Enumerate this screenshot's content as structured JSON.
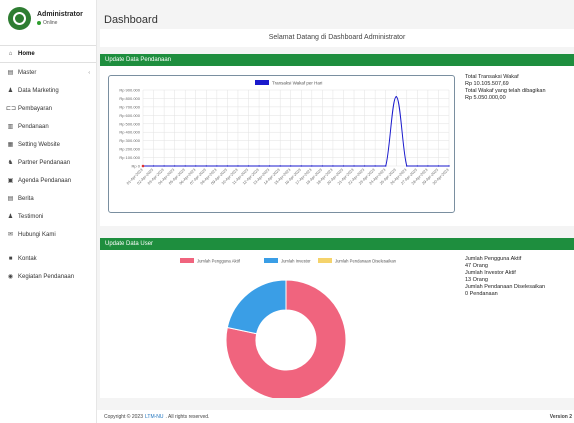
{
  "user": {
    "name": "Administrator",
    "status": "Online"
  },
  "sidebar": {
    "items": [
      {
        "label": "Home",
        "icon": "home-icon",
        "glyph": "⌂"
      },
      {
        "label": "Master",
        "icon": "database-icon",
        "glyph": "▤",
        "caret": "‹"
      },
      {
        "label": "Data Marketing",
        "icon": "user-icon",
        "glyph": "♟"
      },
      {
        "label": "Pembayaran",
        "icon": "payment-icon",
        "glyph": "⊏⊐"
      },
      {
        "label": "Pendanaan",
        "icon": "bank-icon",
        "glyph": "▥"
      },
      {
        "label": "Setting Website",
        "icon": "settings-icon",
        "glyph": "▦"
      },
      {
        "label": "Partner Pendanaan",
        "icon": "users-icon",
        "glyph": "♞"
      },
      {
        "label": "Agenda Pendanaan",
        "icon": "calendar-icon",
        "glyph": "▣"
      },
      {
        "label": "Berita",
        "icon": "newspaper-icon",
        "glyph": "▤"
      },
      {
        "label": "Testimoni",
        "icon": "testimonial-icon",
        "glyph": "♟"
      },
      {
        "label": "Hubungi Kami",
        "icon": "mail-icon",
        "glyph": "✉"
      },
      {
        "label": "Kontak",
        "icon": "address-book-icon",
        "glyph": "■"
      },
      {
        "label": "Kegiatan Pendanaan",
        "icon": "activity-icon",
        "glyph": "◉"
      }
    ]
  },
  "page": {
    "title": "Dashboard",
    "welcome": "Selamat Datang di Dashboard Administrator"
  },
  "funding_card": {
    "header": "Update Data Pendanaan",
    "summary": {
      "total_label": "Total Transaksi Wakaf",
      "total_value": "Rp 10.105.507,69",
      "shared_label": "Total Wakaf yang telah dibagikan",
      "shared_value": "Rp 5.050.000,00"
    }
  },
  "user_card": {
    "header": "Update Data User",
    "summary": {
      "active_label": "Jumlah Pengguna Aktif",
      "active_value": "47 Orang",
      "investor_label": "Jumlah Investor Aktif",
      "investor_value": "13 Orang",
      "funding_label": "Jumlah Pendanaan Diselesaikan",
      "funding_value": "0 Pendanaan"
    }
  },
  "footer": {
    "copyright_prefix": "Copyright © 2023",
    "link": "LTM-NU",
    "copyright_suffix": ". All rights reserved.",
    "version": "Version 2"
  },
  "chart_data": [
    {
      "type": "line",
      "legend": [
        "Transaksi Wakaf per Hari"
      ],
      "colors": [
        "#1a1acc"
      ],
      "yticks": [
        "Rp 900.000",
        "Rp 800.000",
        "Rp 700.000",
        "Rp 600.000",
        "Rp 500.000",
        "Rp 400.000",
        "Rp 300.000",
        "Rp 200.000",
        "Rp 100.000",
        "Rp 0"
      ],
      "ylim": [
        0,
        900000
      ],
      "x": [
        "01-Apr-2023",
        "02-Apr-2023",
        "03-Apr-2023",
        "04-Apr-2023",
        "05-Apr-2023",
        "06-Apr-2023",
        "07-Apr-2023",
        "08-Apr-2023",
        "09-Apr-2023",
        "10-Apr-2023",
        "11-Apr-2023",
        "12-Apr-2023",
        "13-Apr-2023",
        "14-Apr-2023",
        "15-Apr-2023",
        "16-Apr-2023",
        "17-Apr-2023",
        "18-Apr-2023",
        "19-Apr-2023",
        "20-Apr-2023",
        "21-Apr-2023",
        "22-Apr-2023",
        "23-Apr-2023",
        "24-Apr-2023",
        "25-Apr-2023",
        "26-Apr-2023",
        "27-Apr-2023",
        "28-Apr-2023",
        "29-Apr-2023",
        "30-Apr-2023"
      ],
      "series": [
        {
          "name": "Transaksi Wakaf per Hari",
          "values": [
            0,
            0,
            0,
            0,
            0,
            0,
            0,
            0,
            0,
            0,
            0,
            0,
            0,
            0,
            0,
            0,
            0,
            0,
            0,
            0,
            0,
            0,
            0,
            0,
            820000,
            0,
            0,
            0,
            0,
            0
          ]
        }
      ],
      "grid": true,
      "legend_position": "top"
    },
    {
      "type": "pie",
      "donut": true,
      "labels": [
        "Jumlah Pengguna Aktif",
        "Jumlah Investor",
        "Jumlah Pendanaan Diselesaikan"
      ],
      "values": [
        47,
        13,
        0
      ],
      "colors": [
        "#f0647e",
        "#3a9ee6",
        "#f5d36b"
      ],
      "legend_position": "top"
    }
  ]
}
